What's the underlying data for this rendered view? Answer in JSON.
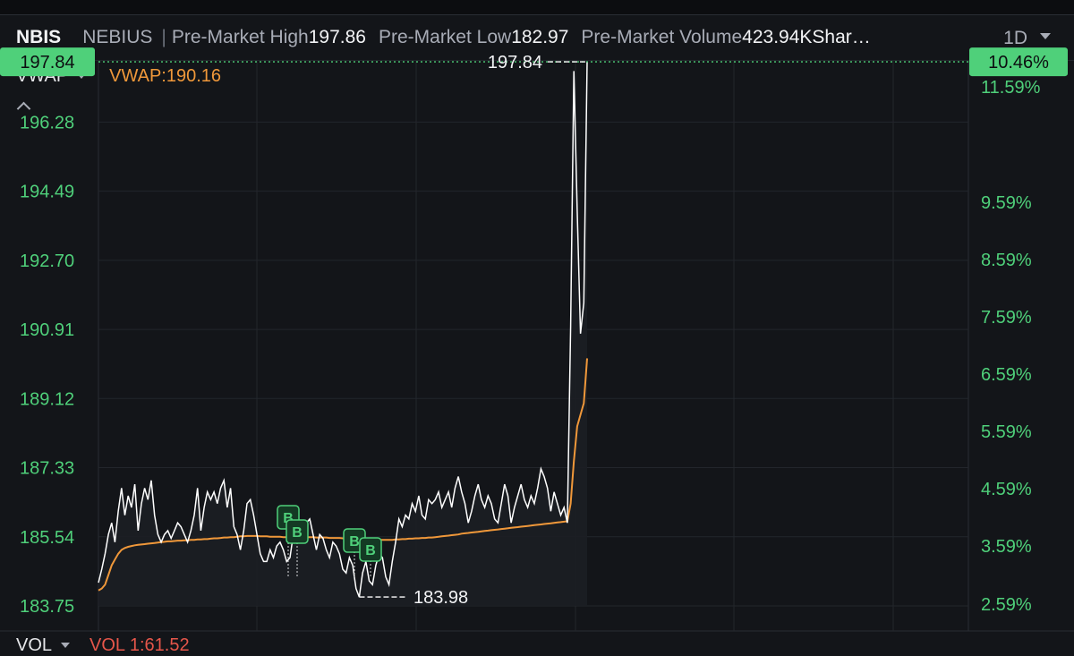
{
  "header": {
    "symbol": "NBIS",
    "name": "NEBIUS",
    "separator": "|",
    "high_label": "Pre-Market High",
    "high_value": "197.86",
    "low_label": "Pre-Market Low",
    "low_value": "182.97",
    "volume_label": "Pre-Market Volume",
    "volume_value": "423.94KShar…",
    "period": "1D"
  },
  "indicator": {
    "name": "VWAP",
    "value": "VWAP:190.16"
  },
  "volume_panel": {
    "name": "VOL",
    "value": "VOL 1:61.52"
  },
  "colors": {
    "background": "#131519",
    "price_line": "#ffffff",
    "vwap_line": "#f0983a",
    "axis_green": "#4fd07a",
    "last_price_badge": "#4fd07a",
    "volume_text": "#e6564a"
  },
  "chart_data": {
    "type": "line",
    "grid": true,
    "legend": "none",
    "ylim": [
      183.75,
      198.56
    ],
    "y_ticks_left": [
      "197.84",
      "196.28",
      "194.49",
      "192.70",
      "190.91",
      "189.12",
      "187.33",
      "185.54",
      "183.75"
    ],
    "y_ticks_right": [
      "11.59%",
      "10.46%",
      "9.59%",
      "8.59%",
      "7.59%",
      "6.59%",
      "5.59%",
      "4.59%",
      "3.59%",
      "2.59%"
    ],
    "last_price_label": "197.84",
    "last_pct_label": "10.46%",
    "high_annotation": "197.84",
    "low_annotation": "183.98",
    "series": [
      {
        "name": "",
        "values": [
          184.35,
          184.7,
          185.1,
          185.6,
          185.9,
          185.4,
          186.2,
          186.8,
          186.1,
          186.6,
          186.3,
          186.9,
          185.7,
          186.4,
          186.8,
          186.5,
          187.0,
          186.1,
          185.6,
          185.4,
          185.6,
          185.7,
          185.5,
          185.7,
          185.9,
          185.8,
          185.6,
          185.4,
          185.7,
          186.1,
          186.8,
          185.7,
          186.3,
          186.7,
          186.5,
          186.7,
          186.4,
          186.8,
          187.0,
          186.3,
          186.8,
          185.8,
          185.6,
          185.2,
          185.7,
          186.4,
          186.5,
          186.1,
          185.6,
          185.1,
          184.9,
          184.9,
          185.2,
          185.0,
          185.3,
          185.4,
          185.2,
          184.9,
          185.0,
          185.6,
          185.8,
          185.7,
          185.4,
          185.9,
          186.0,
          185.6,
          185.2,
          185.6,
          185.5,
          185.2,
          185.0,
          185.4,
          185.3,
          185.1,
          184.7,
          184.6,
          185.0,
          184.8,
          184.2,
          183.98,
          184.6,
          184.9,
          184.4,
          184.3,
          184.8,
          185.1,
          185.0,
          184.5,
          184.3,
          184.9,
          185.4,
          186.0,
          185.8,
          186.1,
          186.0,
          186.4,
          186.2,
          186.6,
          186.1,
          186.0,
          186.5,
          186.4,
          186.5,
          186.7,
          186.3,
          186.5,
          186.7,
          186.3,
          186.8,
          187.1,
          186.7,
          186.4,
          185.9,
          186.2,
          186.6,
          186.9,
          186.5,
          186.3,
          186.6,
          186.4,
          186.0,
          185.9,
          186.4,
          186.9,
          186.6,
          185.9,
          186.3,
          186.6,
          186.9,
          186.5,
          186.3,
          186.6,
          186.4,
          186.8,
          187.3,
          187.1,
          186.8,
          186.2,
          186.7,
          186.4,
          186.1,
          186.3,
          185.9,
          191.0,
          197.6,
          194.0,
          190.8,
          191.6,
          197.84
        ]
      },
      {
        "name": "",
        "values": [
          184.15,
          184.2,
          184.3,
          184.55,
          184.8,
          184.95,
          185.1,
          185.2,
          185.25,
          185.28,
          185.3,
          185.32,
          185.33,
          185.34,
          185.35,
          185.36,
          185.37,
          185.38,
          185.39,
          185.4,
          185.41,
          185.42,
          185.42,
          185.43,
          185.44,
          185.44,
          185.45,
          185.45,
          185.46,
          185.46,
          185.47,
          185.47,
          185.48,
          185.48,
          185.49,
          185.5,
          185.5,
          185.51,
          185.52,
          185.52,
          185.53,
          185.53,
          185.54,
          185.55,
          185.55,
          185.56,
          185.56,
          185.56,
          185.56,
          185.55,
          185.55,
          185.55,
          185.54,
          185.54,
          185.54,
          185.54,
          185.53,
          185.53,
          185.53,
          185.53,
          185.53,
          185.53,
          185.53,
          185.53,
          185.53,
          185.53,
          185.52,
          185.52,
          185.52,
          185.52,
          185.51,
          185.51,
          185.51,
          185.51,
          185.5,
          185.5,
          185.5,
          185.49,
          185.49,
          185.48,
          185.48,
          185.47,
          185.47,
          185.46,
          185.46,
          185.46,
          185.46,
          185.46,
          185.46,
          185.46,
          185.47,
          185.47,
          185.48,
          185.48,
          185.49,
          185.49,
          185.5,
          185.5,
          185.51,
          185.51,
          185.52,
          185.52,
          185.53,
          185.54,
          185.55,
          185.56,
          185.57,
          185.58,
          185.59,
          185.6,
          185.62,
          185.63,
          185.64,
          185.65,
          185.66,
          185.67,
          185.68,
          185.69,
          185.7,
          185.71,
          185.72,
          185.73,
          185.74,
          185.75,
          185.76,
          185.77,
          185.78,
          185.79,
          185.8,
          185.81,
          185.82,
          185.83,
          185.84,
          185.85,
          185.86,
          185.87,
          185.88,
          185.89,
          185.9,
          185.91,
          185.92,
          185.93,
          185.94,
          186.4,
          187.5,
          188.4,
          188.7,
          189.0,
          190.16
        ]
      }
    ],
    "trade_markers": [
      "B",
      "B",
      "B",
      "B"
    ]
  }
}
